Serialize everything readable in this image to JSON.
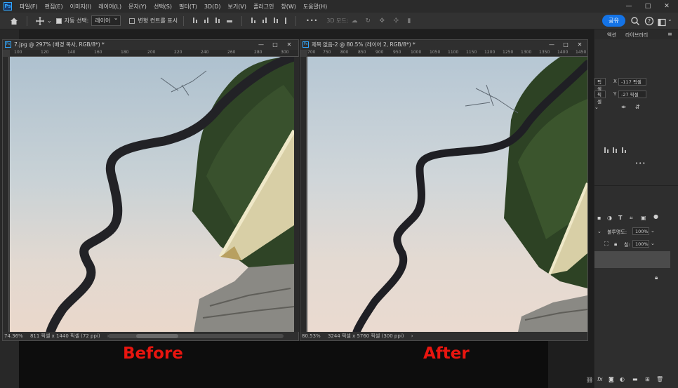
{
  "app": {
    "logo": "Ps",
    "menu": [
      "파일(F)",
      "편집(E)",
      "이미지(I)",
      "레이어(L)",
      "문자(Y)",
      "선택(S)",
      "필터(T)",
      "3D(D)",
      "보기(V)",
      "플러그인",
      "창(W)",
      "도움말(H)"
    ],
    "window_controls": [
      "—",
      "□",
      "✕"
    ]
  },
  "options": {
    "auto_select_label": "자동 선택:",
    "auto_select_value": "레이어",
    "transform_label": "변형 컨트롤 표시",
    "more": "•••",
    "mode3d": "3D 모드:",
    "share": "공유"
  },
  "doc_left": {
    "title": "7.jpg @ 297% (배경 복사, RGB/8*) *",
    "ruler_ticks": [
      "100",
      "120",
      "140",
      "160",
      "180",
      "200",
      "220",
      "240",
      "260",
      "280",
      "300"
    ],
    "zoom": "74.36%",
    "info": "811 픽셀 x 1440 픽셀 (72 ppi)"
  },
  "doc_right": {
    "title": "제목 없음-2 @ 80.5% (레이어 2, RGB/8*) *",
    "ruler_ticks": [
      "700",
      "750",
      "800",
      "850",
      "900",
      "950",
      "1000",
      "1050",
      "1100",
      "1150",
      "1200",
      "1250",
      "1300",
      "1350",
      "1400",
      "1450"
    ],
    "zoom": "80.53%",
    "info": "3244 픽셀 x 5760 픽셀 (300 ppi)"
  },
  "panel": {
    "tabs": [
      "액션",
      "라이브러리"
    ],
    "x_label": "X",
    "x_value": "-117 픽셀",
    "w_value": "픽셀",
    "y_label": "Y",
    "y_value": "-27 픽셀",
    "opacity_label": "불투명도:",
    "opacity_value": "100%",
    "fill_label": "칠:",
    "fill_value": "100%",
    "more": "•••"
  },
  "labels": {
    "before": "Before",
    "after": "After"
  },
  "colors": {
    "accent": "#1473e6",
    "label": "#e8150f"
  }
}
